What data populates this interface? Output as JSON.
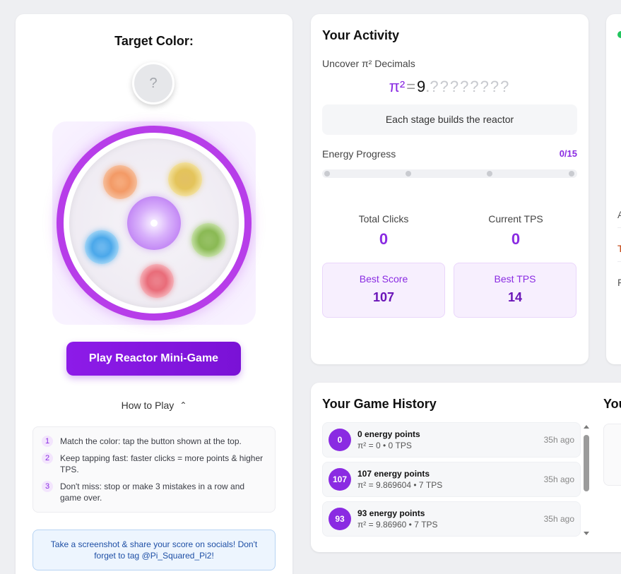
{
  "left": {
    "target_title": "Target Color:",
    "target_symbol": "?",
    "play_button": "Play Reactor Mini-Game",
    "how_to_play": "How to Play",
    "rules": [
      {
        "num": "1",
        "text": "Match the color: tap the button shown at the top."
      },
      {
        "num": "2",
        "text": "Keep tapping fast: faster clicks = more points & higher TPS."
      },
      {
        "num": "3",
        "text": "Don't miss: stop or make 3 mistakes in a row and game over."
      }
    ],
    "share_text": "Take a screenshot & share your score on socials! Don't forget to tag @Pi_Squared_Pi2!"
  },
  "activity": {
    "title": "Your Activity",
    "uncover_label": "Uncover π² Decimals",
    "pi_symbol": "π²",
    "pi_equals": "=",
    "pi_integer": "9",
    "pi_dot": ".",
    "pi_hidden": "????????",
    "stage_text": "Each stage builds the reactor",
    "energy_label": "Energy Progress",
    "energy_value": "0/15",
    "energy_fraction": 0,
    "total_clicks_label": "Total Clicks",
    "total_clicks": "0",
    "current_tps_label": "Current TPS",
    "current_tps": "0",
    "best_score_label": "Best Score",
    "best_score": "107",
    "best_tps_label": "Best TPS",
    "best_tps": "14"
  },
  "right_fragments": [
    "A",
    "T",
    "F"
  ],
  "history": {
    "title": "Your Game History",
    "second_title_fragment": "You",
    "items": [
      {
        "badge": "0",
        "points": "0 energy points",
        "sub": "π² = 0 • 0 TPS",
        "time": "35h ago"
      },
      {
        "badge": "107",
        "points": "107 energy points",
        "sub": "π² = 9.869604 • 7 TPS",
        "time": "35h ago"
      },
      {
        "badge": "93",
        "points": "93 energy points",
        "sub": "π² = 9.86960 • 7 TPS",
        "time": "35h ago"
      }
    ]
  },
  "colors": {
    "accent": "#8a2be2",
    "status_dot": "#22c55e"
  }
}
